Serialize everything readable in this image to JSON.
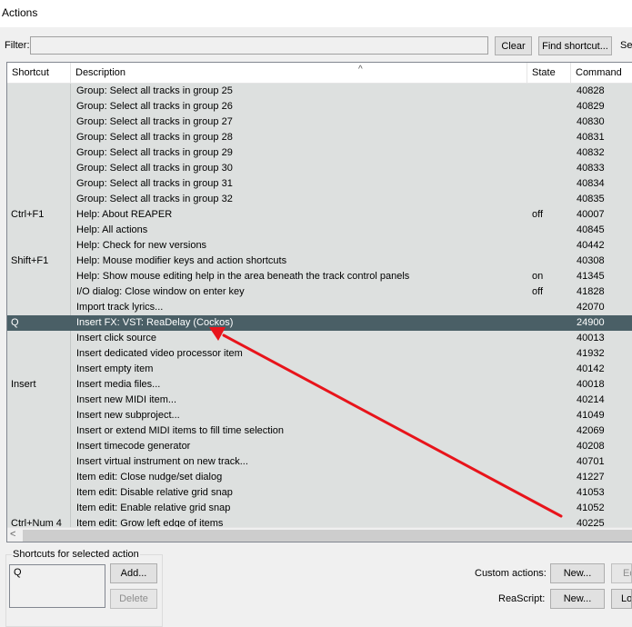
{
  "window": {
    "title": "Actions"
  },
  "filter": {
    "label": "Filter:",
    "value": ""
  },
  "buttons": {
    "clear": "Clear",
    "find_shortcut": "Find shortcut...",
    "section": "Se"
  },
  "columns": {
    "shortcut": "Shortcut",
    "description": "Description",
    "state": "State",
    "command_id": "Command ID"
  },
  "sort_indicator": "^",
  "selected_index": 15,
  "actions": [
    {
      "shortcut": "",
      "description": "Group: Select all tracks in group 25",
      "state": "",
      "id": "40828"
    },
    {
      "shortcut": "",
      "description": "Group: Select all tracks in group 26",
      "state": "",
      "id": "40829"
    },
    {
      "shortcut": "",
      "description": "Group: Select all tracks in group 27",
      "state": "",
      "id": "40830"
    },
    {
      "shortcut": "",
      "description": "Group: Select all tracks in group 28",
      "state": "",
      "id": "40831"
    },
    {
      "shortcut": "",
      "description": "Group: Select all tracks in group 29",
      "state": "",
      "id": "40832"
    },
    {
      "shortcut": "",
      "description": "Group: Select all tracks in group 30",
      "state": "",
      "id": "40833"
    },
    {
      "shortcut": "",
      "description": "Group: Select all tracks in group 31",
      "state": "",
      "id": "40834"
    },
    {
      "shortcut": "",
      "description": "Group: Select all tracks in group 32",
      "state": "",
      "id": "40835"
    },
    {
      "shortcut": "Ctrl+F1",
      "description": "Help: About REAPER",
      "state": "off",
      "id": "40007"
    },
    {
      "shortcut": "",
      "description": "Help: All actions",
      "state": "",
      "id": "40845"
    },
    {
      "shortcut": "",
      "description": "Help: Check for new versions",
      "state": "",
      "id": "40442"
    },
    {
      "shortcut": "Shift+F1",
      "description": "Help: Mouse modifier keys and action shortcuts",
      "state": "",
      "id": "40308"
    },
    {
      "shortcut": "",
      "description": "Help: Show mouse editing help in the area beneath the track control panels",
      "state": "on",
      "id": "41345"
    },
    {
      "shortcut": "",
      "description": "I/O dialog: Close window on enter key",
      "state": "off",
      "id": "41828"
    },
    {
      "shortcut": "",
      "description": "Import track lyrics...",
      "state": "",
      "id": "42070"
    },
    {
      "shortcut": "Q",
      "description": "Insert FX: VST: ReaDelay (Cockos)",
      "state": "",
      "id": "24900"
    },
    {
      "shortcut": "",
      "description": "Insert click source",
      "state": "",
      "id": "40013"
    },
    {
      "shortcut": "",
      "description": "Insert dedicated video processor item",
      "state": "",
      "id": "41932"
    },
    {
      "shortcut": "",
      "description": "Insert empty item",
      "state": "",
      "id": "40142"
    },
    {
      "shortcut": "Insert",
      "description": "Insert media files...",
      "state": "",
      "id": "40018"
    },
    {
      "shortcut": "",
      "description": "Insert new MIDI item...",
      "state": "",
      "id": "40214"
    },
    {
      "shortcut": "",
      "description": "Insert new subproject...",
      "state": "",
      "id": "41049"
    },
    {
      "shortcut": "",
      "description": "Insert or extend MIDI items to fill time selection",
      "state": "",
      "id": "42069"
    },
    {
      "shortcut": "",
      "description": "Insert timecode generator",
      "state": "",
      "id": "40208"
    },
    {
      "shortcut": "",
      "description": "Insert virtual instrument on new track...",
      "state": "",
      "id": "40701"
    },
    {
      "shortcut": "",
      "description": "Item edit: Close nudge/set dialog",
      "state": "",
      "id": "41227"
    },
    {
      "shortcut": "",
      "description": "Item edit: Disable relative grid snap",
      "state": "",
      "id": "41053"
    },
    {
      "shortcut": "",
      "description": "Item edit: Enable relative grid snap",
      "state": "",
      "id": "41052"
    },
    {
      "shortcut": "Ctrl+Num 4",
      "description": "Item edit: Grow left edge of items",
      "state": "",
      "id": "40225"
    }
  ],
  "scroll": {
    "left_arrow": "<"
  },
  "shortcuts_panel": {
    "label": "Shortcuts for selected action",
    "items": [
      "Q"
    ],
    "add": "Add...",
    "delete": "Delete"
  },
  "custom_actions": {
    "label": "Custom actions:",
    "new": "New...",
    "edit": "Ed"
  },
  "reascript": {
    "label": "ReaScript:",
    "new": "New...",
    "load": "Lo"
  },
  "colors": {
    "selection": "#4a5f66",
    "list_bg": "#dde0df",
    "arrow": "#e8141b"
  }
}
